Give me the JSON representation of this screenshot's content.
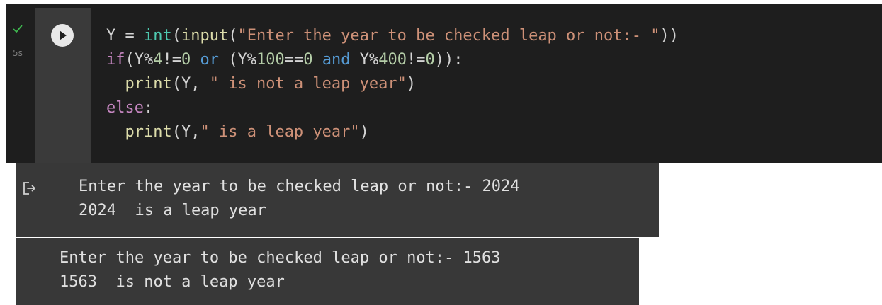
{
  "cell": {
    "status": {
      "icon": "check-icon",
      "exec_time": "5s",
      "color": "#3fb950"
    },
    "run_button": {
      "icon": "play-icon"
    },
    "code": {
      "line1": [
        {
          "t": "Y = ",
          "c": "tx"
        },
        {
          "t": "int",
          "c": "bi"
        },
        {
          "t": "(",
          "c": "tx"
        },
        {
          "t": "input",
          "c": "fn"
        },
        {
          "t": "(",
          "c": "tx"
        },
        {
          "t": "\"Enter the year to be checked leap or not:- \"",
          "c": "str"
        },
        {
          "t": "))",
          "c": "tx"
        }
      ],
      "line2": [
        {
          "t": "if",
          "c": "kw"
        },
        {
          "t": "(Y%",
          "c": "tx"
        },
        {
          "t": "4",
          "c": "num"
        },
        {
          "t": "!=",
          "c": "tx"
        },
        {
          "t": "0",
          "c": "num"
        },
        {
          "t": " ",
          "c": "tx"
        },
        {
          "t": "or",
          "c": "op"
        },
        {
          "t": " (Y%",
          "c": "tx"
        },
        {
          "t": "100",
          "c": "num"
        },
        {
          "t": "==",
          "c": "tx"
        },
        {
          "t": "0",
          "c": "num"
        },
        {
          "t": " ",
          "c": "tx"
        },
        {
          "t": "and",
          "c": "op"
        },
        {
          "t": " Y%",
          "c": "tx"
        },
        {
          "t": "400",
          "c": "num"
        },
        {
          "t": "!=",
          "c": "tx"
        },
        {
          "t": "0",
          "c": "num"
        },
        {
          "t": ")):",
          "c": "tx"
        }
      ],
      "line3": [
        {
          "t": "  ",
          "c": "tx"
        },
        {
          "t": "print",
          "c": "fn"
        },
        {
          "t": "(Y, ",
          "c": "tx"
        },
        {
          "t": "\" is not a leap year\"",
          "c": "str"
        },
        {
          "t": ")",
          "c": "tx"
        }
      ],
      "line4": [
        {
          "t": "else",
          "c": "kw"
        },
        {
          "t": ":",
          "c": "tx"
        }
      ],
      "line5": [
        {
          "t": "  ",
          "c": "tx"
        },
        {
          "t": "print",
          "c": "fn"
        },
        {
          "t": "(Y,",
          "c": "tx"
        },
        {
          "t": "\" is a leap year\"",
          "c": "str"
        },
        {
          "t": ")",
          "c": "tx"
        }
      ]
    }
  },
  "outputs": {
    "icon": "output-redirect-icon",
    "run1": {
      "line1": "Enter the year to be checked leap or not:- 2024",
      "line2": "2024  is a leap year"
    },
    "run2": {
      "line1": "Enter the year to be checked leap or not:- 1563",
      "line2": "1563  is not a leap year"
    }
  }
}
